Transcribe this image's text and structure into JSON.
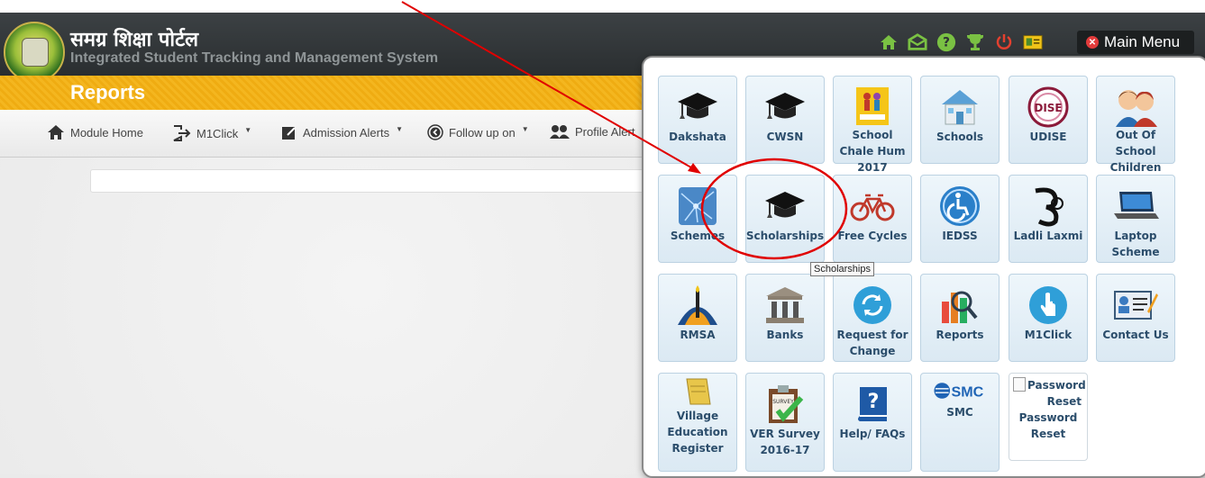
{
  "header": {
    "title_hindi": "समग्र शिक्षा पोर्टल",
    "title_english": "Integrated Student Tracking and Management System",
    "main_menu_label": "Main Menu",
    "icons": [
      "home-icon",
      "mail-icon",
      "help-icon",
      "trophy-icon",
      "power-icon",
      "profile-card-icon"
    ]
  },
  "reports": {
    "title": "Reports"
  },
  "nav": {
    "items": [
      {
        "label": "Module Home",
        "icon": "home-icon"
      },
      {
        "label": "M1Click",
        "icon": "signin-icon"
      },
      {
        "label": "Admission Alerts",
        "icon": "edit-icon"
      },
      {
        "label": "Follow up on",
        "icon": "circle-arrow-icon"
      },
      {
        "label": "Profile Alert",
        "icon": "users-icon"
      }
    ]
  },
  "menu": {
    "tiles": [
      {
        "label": "Dakshata",
        "icon": "graduation-cap-icon"
      },
      {
        "label": "CWSN",
        "icon": "graduation-cap-icon"
      },
      {
        "label": "School Chale Hum 2017",
        "icon": "children-poster-icon"
      },
      {
        "label": "Schools",
        "icon": "school-building-icon"
      },
      {
        "label": "UDISE",
        "icon": "udise-logo-icon"
      },
      {
        "label": "Out Of School Children",
        "icon": "children-icon"
      },
      {
        "label": "Schemes",
        "icon": "network-map-icon"
      },
      {
        "label": "Scholarships",
        "icon": "graduation-cap-icon"
      },
      {
        "label": "Free Cycles",
        "icon": "bicycle-icon"
      },
      {
        "label": "IEDSS",
        "icon": "wheelchair-icon"
      },
      {
        "label": "Ladli Laxmi",
        "icon": "ladli-logo-icon"
      },
      {
        "label": "Laptop Scheme",
        "icon": "laptop-icon"
      },
      {
        "label": "RMSA",
        "icon": "rmsa-logo-icon"
      },
      {
        "label": "Banks",
        "icon": "bank-icon"
      },
      {
        "label": "Request for Change",
        "icon": "refresh-icon"
      },
      {
        "label": "Reports",
        "icon": "report-chart-icon"
      },
      {
        "label": "M1Click",
        "icon": "hand-pointer-icon"
      },
      {
        "label": "Contact Us",
        "icon": "contact-card-icon"
      },
      {
        "label": "Village Education Register",
        "icon": "notepad-icon"
      },
      {
        "label": "VER Survey 2016-17",
        "icon": "survey-clipboard-icon"
      },
      {
        "label": "Help/ FAQs",
        "icon": "help-book-icon"
      },
      {
        "label": "SMC",
        "icon": "smc-logo-icon"
      },
      {
        "label": "Password Reset",
        "icon": "broken-image-icon",
        "alt": "Password Reset"
      }
    ],
    "tooltip": "Scholarships"
  },
  "colors": {
    "header_bg": "#2f3335",
    "reports_bar": "#f2b01a",
    "tile_label": "#2b4d6b",
    "annotation_red": "#e00000"
  }
}
